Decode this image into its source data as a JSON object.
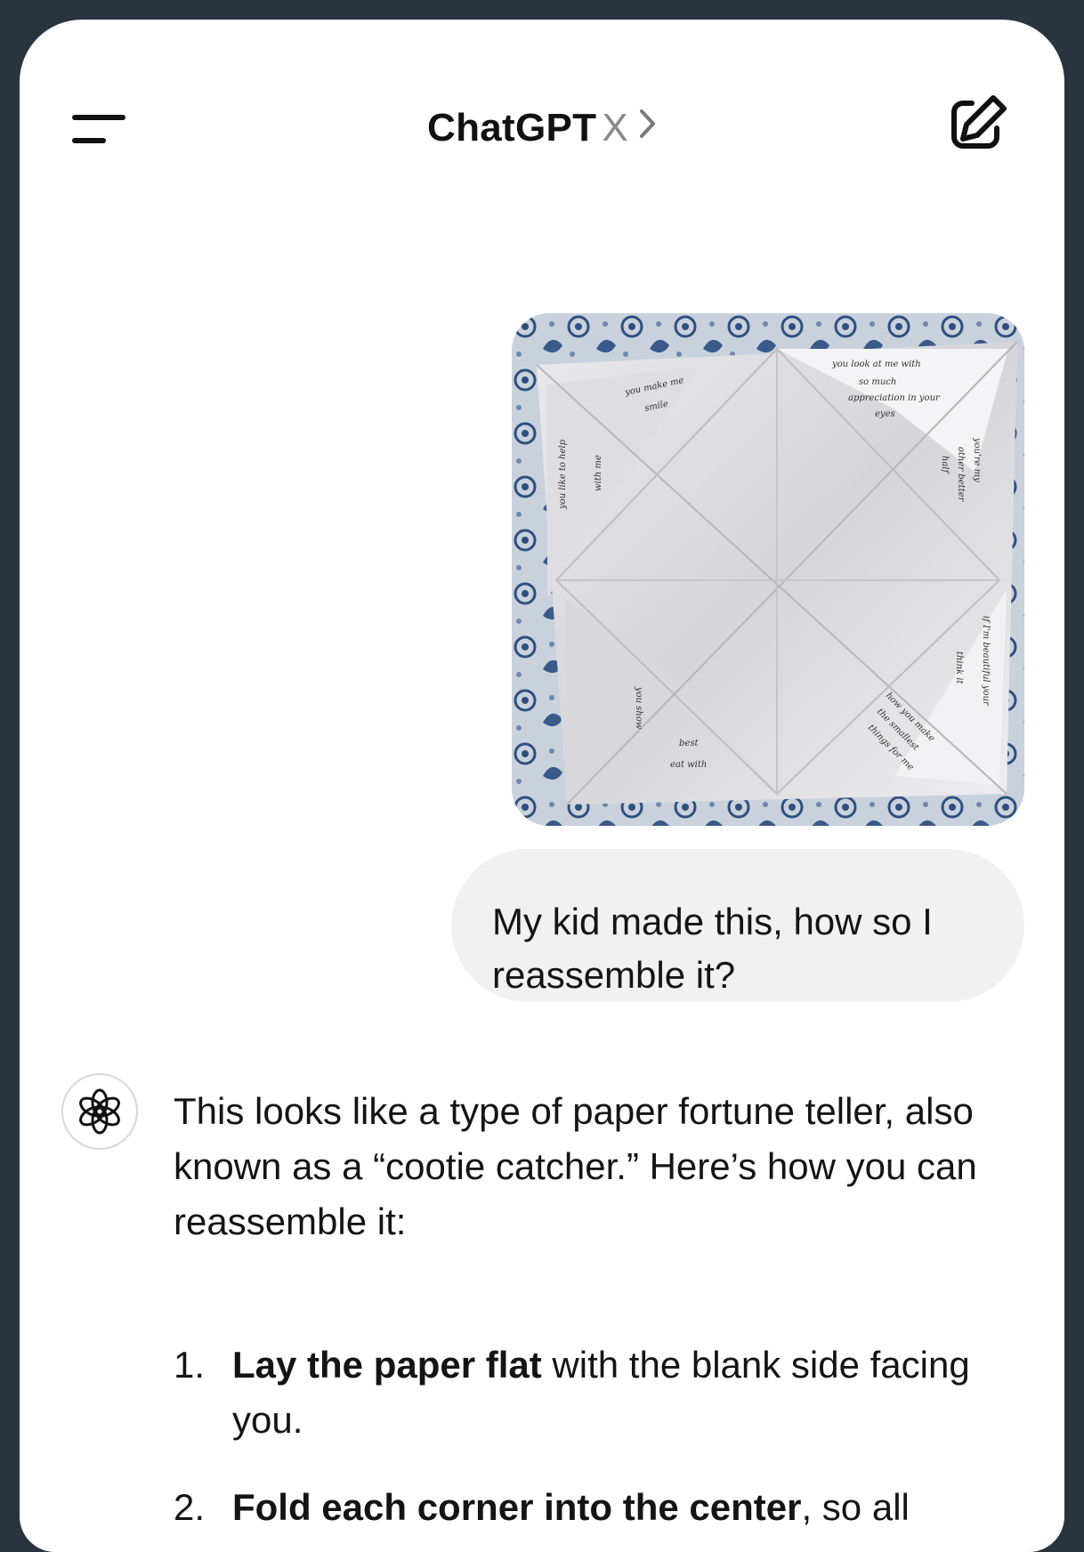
{
  "header": {
    "brand": "ChatGPT",
    "model": "X",
    "menu_icon": "menu-icon",
    "title_chevron_icon": "chevron-right-icon",
    "new_chat_icon": "compose-icon"
  },
  "conversation": {
    "user_message": {
      "image": {
        "description_icon": "photo-attachment",
        "handwriting": [
          "you look at me with",
          "so much",
          "appreciation in your",
          "eyes",
          "you make me",
          "smile",
          "you're my",
          "other better",
          "half",
          "you like to help",
          "with me",
          "if I'm beautiful your",
          "think it",
          "you show",
          "how you make",
          "the smallest",
          "things for me",
          "best",
          "eat with"
        ]
      },
      "text": "My kid made this, how so I reassemble it?"
    },
    "assistant_message": {
      "avatar_icon": "chatgpt-logo-icon",
      "intro": "This looks like a type of paper fortune teller, also known as a “cootie catcher.” Here’s how you can reassemble it:",
      "steps": [
        {
          "num": "1.",
          "bold": "Lay the paper flat",
          "rest": " with the blank side facing you."
        },
        {
          "num": "2.",
          "bold": "Fold each corner into the center",
          "rest": ", so all"
        }
      ]
    }
  },
  "colors": {
    "frame": "#2a343e",
    "bubble": "#f1f1f1",
    "text": "#141414",
    "muted": "#8a8a8a"
  }
}
